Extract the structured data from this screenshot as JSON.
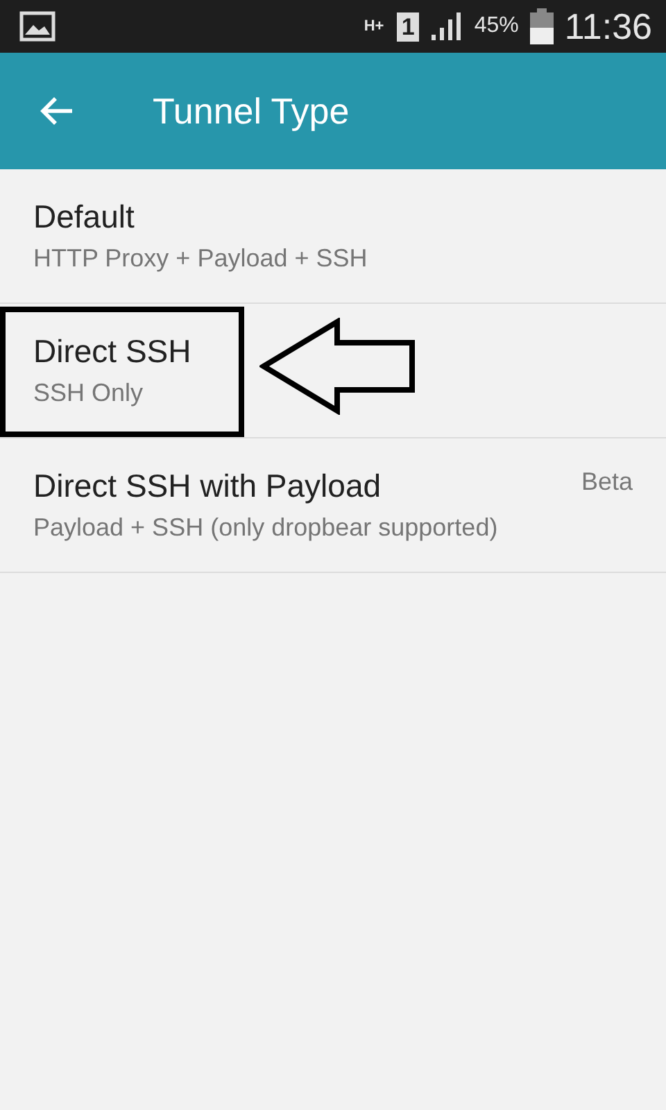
{
  "status_bar": {
    "network": "H+",
    "sim": "1",
    "battery": "45%",
    "time": "11:36"
  },
  "app_bar": {
    "title": "Tunnel Type"
  },
  "items": [
    {
      "title": "Default",
      "subtitle": "HTTP Proxy + Payload + SSH",
      "highlighted": false
    },
    {
      "title": "Direct SSH",
      "subtitle": "SSH Only",
      "highlighted": true
    },
    {
      "title": "Direct SSH with Payload",
      "subtitle": "Payload + SSH (only dropbear supported)",
      "badge": "Beta",
      "highlighted": false
    }
  ]
}
